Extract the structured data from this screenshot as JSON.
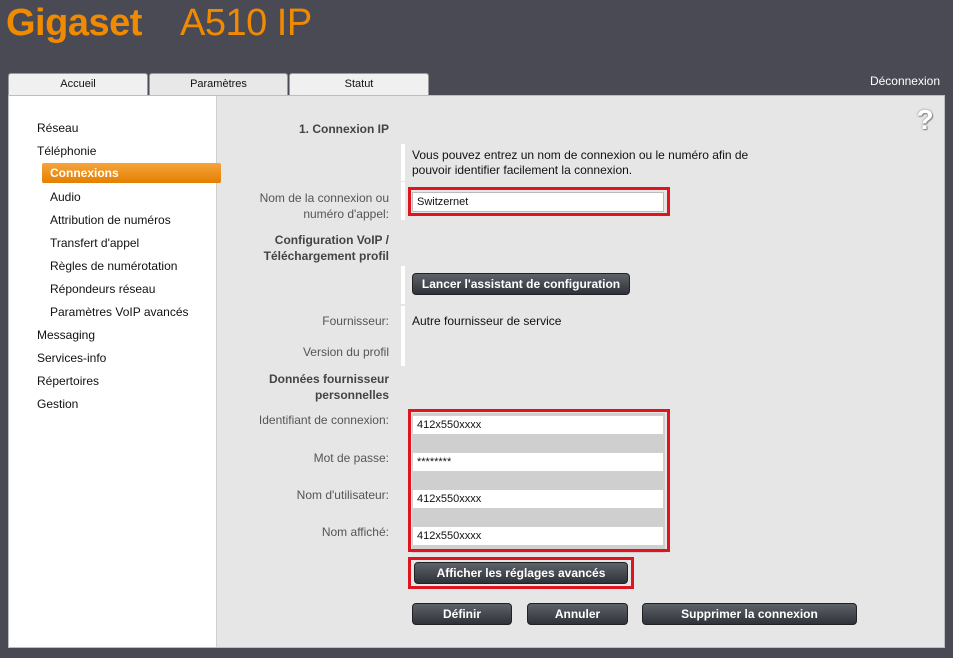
{
  "brand": {
    "logo": "Gigaset",
    "model": "A510 IP"
  },
  "tabs": [
    {
      "label": "Accueil"
    },
    {
      "label": "Paramètres"
    },
    {
      "label": "Statut"
    }
  ],
  "header": {
    "logout": "Déconnexion"
  },
  "sidebar": {
    "reseau": "Réseau",
    "telephonie": "Téléphonie",
    "connexions": "Connexions",
    "audio": "Audio",
    "attribution": "Attribution de numéros",
    "transfert": "Transfert d'appel",
    "regles": "Règles de numérotation",
    "repondeurs": "Répondeurs réseau",
    "voip_avances": "Paramètres VoIP avancés",
    "messaging": "Messaging",
    "services_info": "Services-info",
    "repertoires": "Répertoires",
    "gestion": "Gestion"
  },
  "help": "?",
  "form": {
    "section_title": "1. Connexion IP",
    "info_line1": "Vous pouvez entrez un nom de connexion ou le numéro afin de",
    "info_line2": "pouvoir identifier facilement la connexion.",
    "name_label_1": "Nom de la connexion ou",
    "name_label_2": "numéro d'appel:",
    "name_value": "Switzernet",
    "voip_title_1": "Configuration VoIP /",
    "voip_title_2": "Téléchargement profil",
    "wizard_button": "Lancer l'assistant de configuration",
    "provider_label": "Fournisseur:",
    "provider_value": "Autre fournisseur de service",
    "profile_version_label": "Version du profil",
    "personal_title_1": "Données fournisseur",
    "personal_title_2": "personnelles",
    "login_label": "Identifiant de connexion:",
    "login_value": "412x550xxxx",
    "password_label": "Mot de passe:",
    "password_value": "********",
    "username_label": "Nom d'utilisateur:",
    "username_value": "412x550xxxx",
    "display_label": "Nom affiché:",
    "display_value": "412x550xxxx",
    "advanced_button": "Afficher les réglages avancés",
    "define_button": "Définir",
    "cancel_button": "Annuler",
    "delete_button": "Supprimer la connexion"
  },
  "colors": {
    "brand": "#f08a00",
    "active_nav": "#e47f00",
    "highlight": "#e0141e",
    "button": "#2f3238"
  }
}
